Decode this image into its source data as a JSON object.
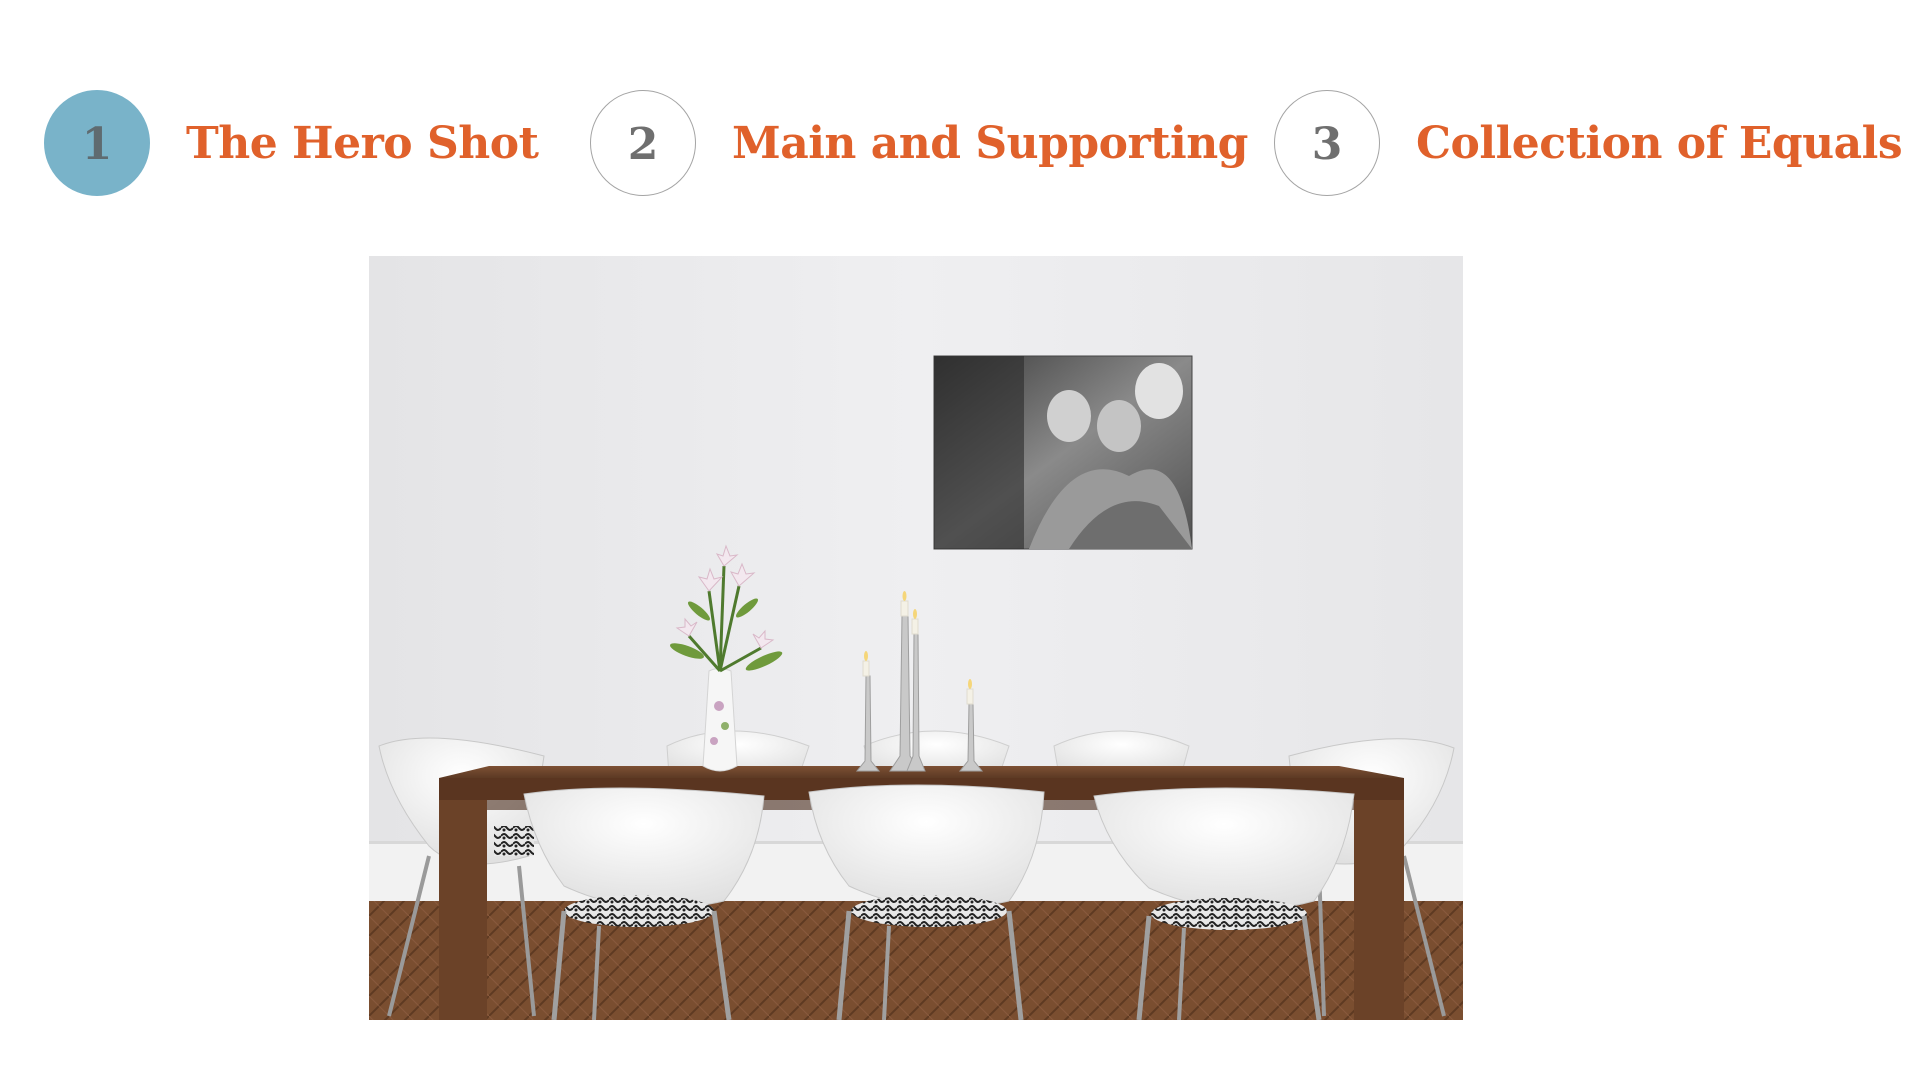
{
  "steps": [
    {
      "number": "1",
      "label": "The Hero Shot",
      "active": true
    },
    {
      "number": "2",
      "label": "Main and Supporting",
      "active": false
    },
    {
      "number": "3",
      "label": "Collection of Equals",
      "active": false
    }
  ],
  "colors": {
    "accent": "#e0612b",
    "active_circle": "#79b3c9",
    "circle_border": "#a4a4a4"
  }
}
